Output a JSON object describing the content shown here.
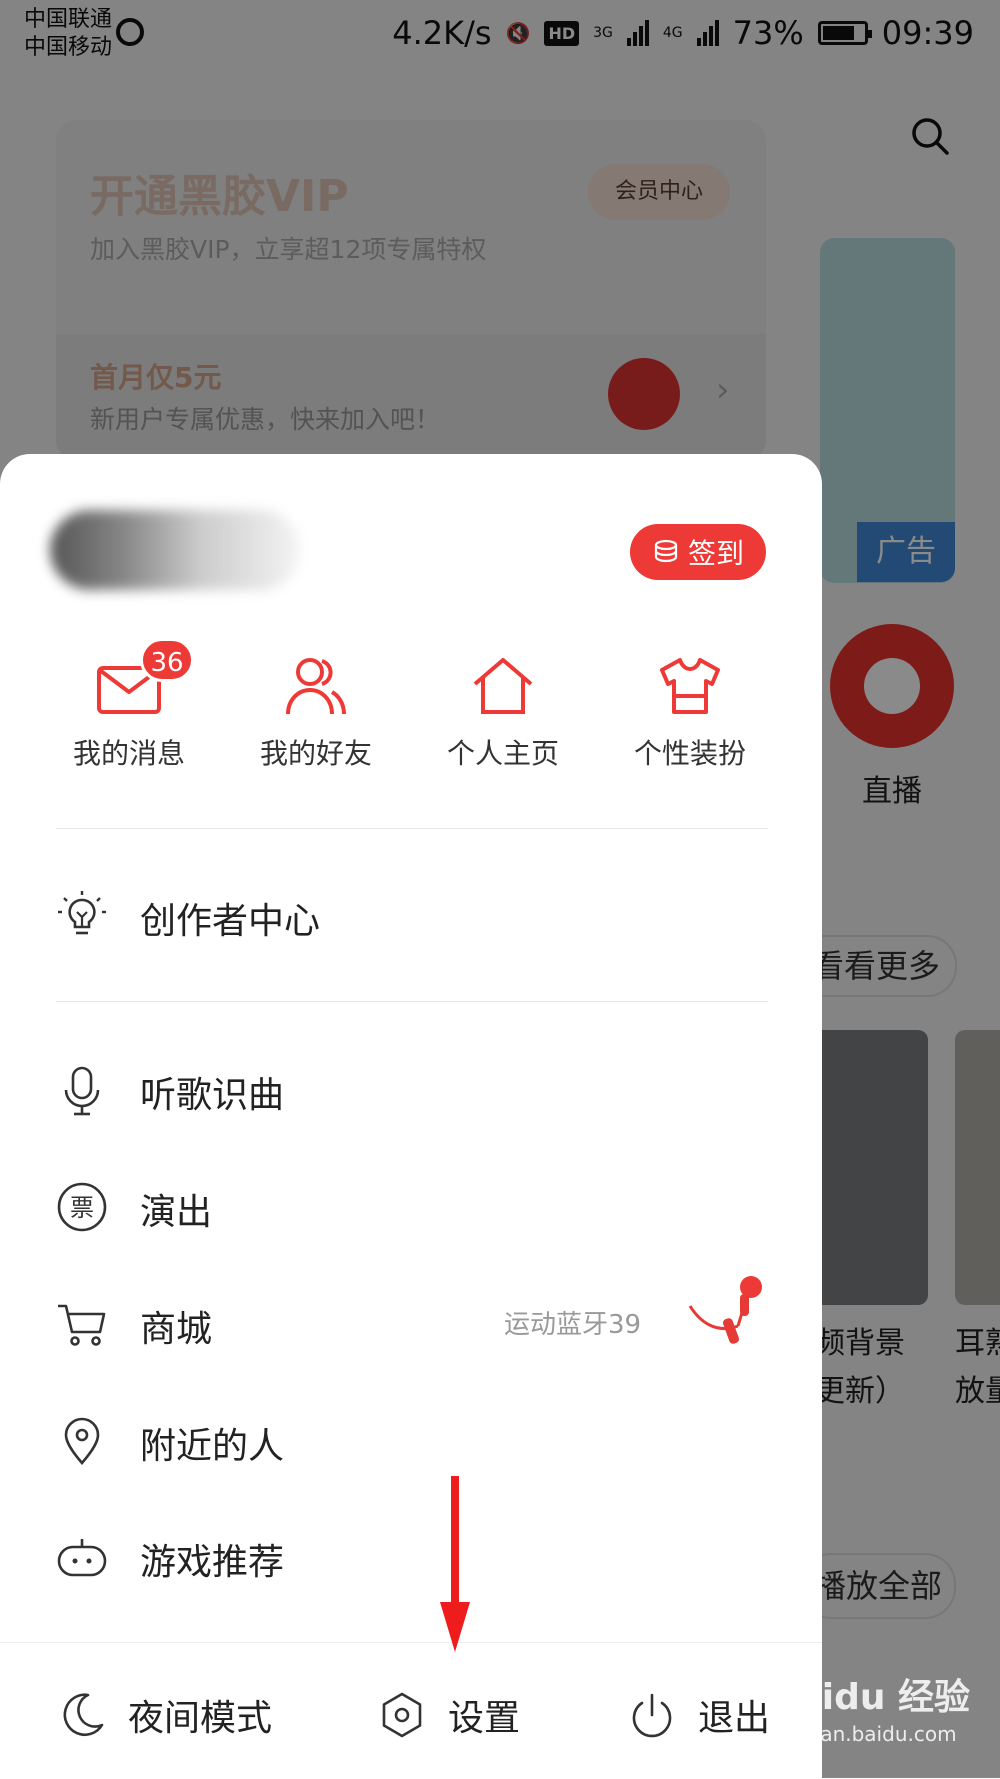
{
  "status_bar": {
    "carrier1": "中国联通",
    "carrier2": "中国移动",
    "speed": "4.2K/s",
    "hd": "HD",
    "net1": "3G",
    "net2": "4G",
    "battery": "73%",
    "time": "09:39"
  },
  "vip": {
    "title": "开通黑胶VIP",
    "subtitle": "加入黑胶VIP，立享超12项专属特权",
    "center_button": "会员中心",
    "promo_title": "首月仅5元",
    "promo_sub": "新用户专属优惠，快来加入吧！"
  },
  "background": {
    "ad_label": "广告",
    "live_label": "直播",
    "see_more": "看看更多",
    "thumb_caption1": "频背景\n更新）",
    "thumb_caption2": "耳熟\n放量",
    "play_all": "播放全部"
  },
  "drawer": {
    "signin_label": "签到",
    "quick_actions": [
      {
        "label": "我的消息",
        "icon": "mail-icon",
        "badge": "36"
      },
      {
        "label": "我的好友",
        "icon": "friends-icon"
      },
      {
        "label": "个人主页",
        "icon": "home-icon"
      },
      {
        "label": "个性装扮",
        "icon": "tshirt-icon"
      }
    ],
    "menu": [
      {
        "label": "创作者中心",
        "icon": "lightbulb-icon"
      },
      {
        "label": "听歌识曲",
        "icon": "microphone-icon"
      },
      {
        "label": "演出",
        "icon": "ticket-icon"
      },
      {
        "label": "商城",
        "icon": "cart-icon",
        "extra": "运动蓝牙39"
      },
      {
        "label": "附近的人",
        "icon": "location-pin-icon"
      },
      {
        "label": "游戏推荐",
        "icon": "gamepad-icon"
      }
    ],
    "bottom": {
      "night_mode": "夜间模式",
      "settings": "设置",
      "logout": "退出"
    }
  },
  "watermark": {
    "main": "Baidu 经验",
    "sub": "jingyan.baidu.com"
  },
  "colors": {
    "accent": "#ee3a36",
    "overlay": "rgba(0,0,0,0.46)"
  }
}
